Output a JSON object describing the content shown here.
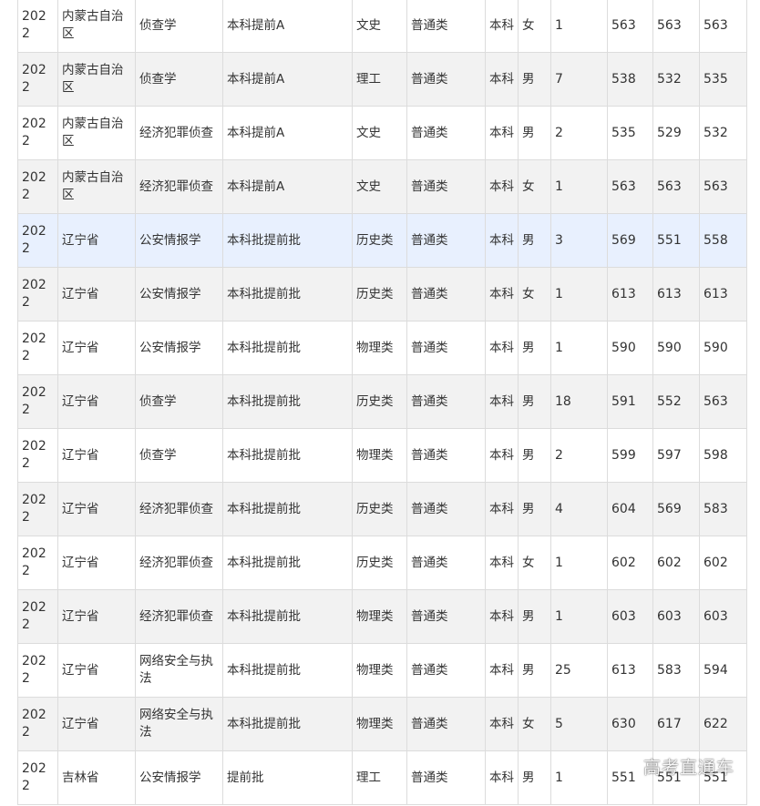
{
  "table": {
    "rows": [
      [
        "2022",
        "内蒙古自治区",
        "侦查学",
        "本科提前A",
        "文史",
        "普通类",
        "本科",
        "女",
        "1",
        "563",
        "563",
        "563"
      ],
      [
        "2022",
        "内蒙古自治区",
        "侦查学",
        "本科提前A",
        "理工",
        "普通类",
        "本科",
        "男",
        "7",
        "538",
        "532",
        "535"
      ],
      [
        "2022",
        "内蒙古自治区",
        "经济犯罪侦查",
        "本科提前A",
        "文史",
        "普通类",
        "本科",
        "男",
        "2",
        "535",
        "529",
        "532"
      ],
      [
        "2022",
        "内蒙古自治区",
        "经济犯罪侦查",
        "本科提前A",
        "文史",
        "普通类",
        "本科",
        "女",
        "1",
        "563",
        "563",
        "563"
      ],
      [
        "2022",
        "辽宁省",
        "公安情报学",
        "本科批提前批",
        "历史类",
        "普通类",
        "本科",
        "男",
        "3",
        "569",
        "551",
        "558"
      ],
      [
        "2022",
        "辽宁省",
        "公安情报学",
        "本科批提前批",
        "历史类",
        "普通类",
        "本科",
        "女",
        "1",
        "613",
        "613",
        "613"
      ],
      [
        "2022",
        "辽宁省",
        "公安情报学",
        "本科批提前批",
        "物理类",
        "普通类",
        "本科",
        "男",
        "1",
        "590",
        "590",
        "590"
      ],
      [
        "2022",
        "辽宁省",
        "侦查学",
        "本科批提前批",
        "历史类",
        "普通类",
        "本科",
        "男",
        "18",
        "591",
        "552",
        "563"
      ],
      [
        "2022",
        "辽宁省",
        "侦查学",
        "本科批提前批",
        "物理类",
        "普通类",
        "本科",
        "男",
        "2",
        "599",
        "597",
        "598"
      ],
      [
        "2022",
        "辽宁省",
        "经济犯罪侦查",
        "本科批提前批",
        "历史类",
        "普通类",
        "本科",
        "男",
        "4",
        "604",
        "569",
        "583"
      ],
      [
        "2022",
        "辽宁省",
        "经济犯罪侦查",
        "本科批提前批",
        "历史类",
        "普通类",
        "本科",
        "女",
        "1",
        "602",
        "602",
        "602"
      ],
      [
        "2022",
        "辽宁省",
        "经济犯罪侦查",
        "本科批提前批",
        "物理类",
        "普通类",
        "本科",
        "男",
        "1",
        "603",
        "603",
        "603"
      ],
      [
        "2022",
        "辽宁省",
        "网络安全与执法",
        "本科批提前批",
        "物理类",
        "普通类",
        "本科",
        "男",
        "25",
        "613",
        "583",
        "594"
      ],
      [
        "2022",
        "辽宁省",
        "网络安全与执法",
        "本科批提前批",
        "物理类",
        "普通类",
        "本科",
        "女",
        "5",
        "630",
        "617",
        "622"
      ],
      [
        "2022",
        "吉林省",
        "公安情报学",
        "提前批",
        "理工",
        "普通类",
        "本科",
        "男",
        "1",
        "551",
        "551",
        "551"
      ]
    ],
    "highlighted_row": 4
  },
  "watermark": "高考直通车"
}
